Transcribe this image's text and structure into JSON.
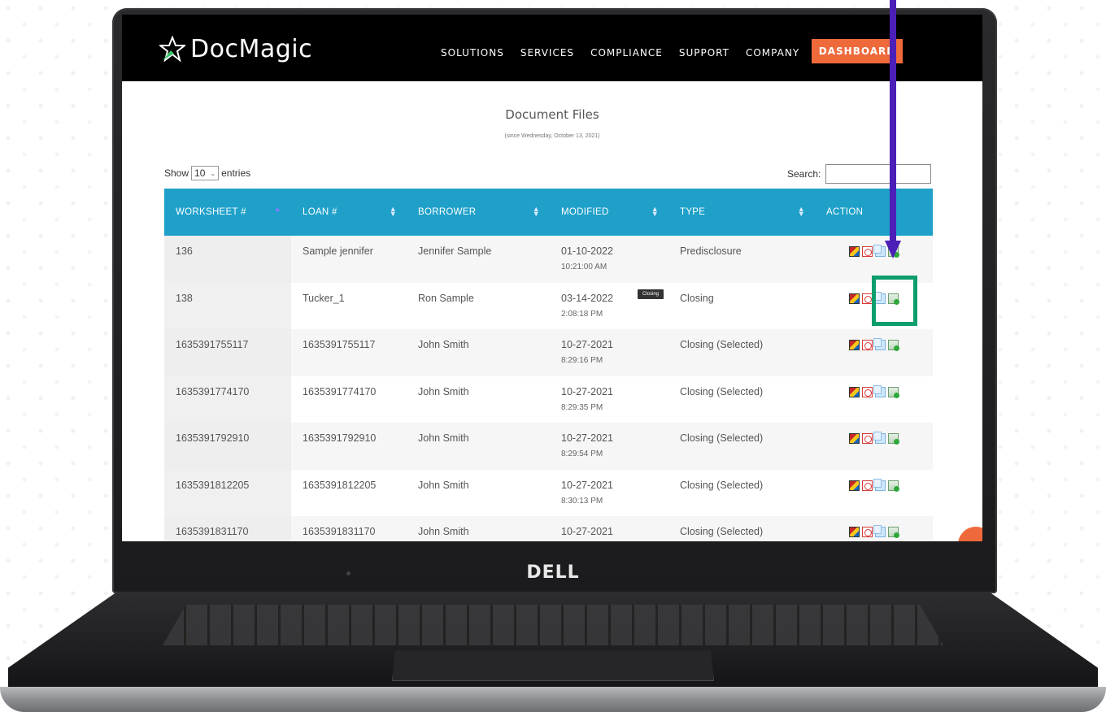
{
  "app": {
    "brand": "DocMagic",
    "nav": [
      "SOLUTIONS",
      "SERVICES",
      "COMPLIANCE",
      "SUPPORT",
      "COMPANY"
    ],
    "dashboard_label": "DASHBOARD"
  },
  "page": {
    "title": "Document Files",
    "subtitle": "(since Wednesday, October 13, 2021)"
  },
  "controls": {
    "show_label": "Show",
    "entries_value": "10",
    "entries_label": "entries",
    "search_label": "Search:",
    "search_value": ""
  },
  "table": {
    "headers": [
      "WORKSHEET #",
      "LOAN #",
      "BORROWER",
      "MODIFIED",
      "TYPE",
      "ACTION"
    ],
    "rows": [
      {
        "worksheet": "136",
        "loan": "Sample jennifer",
        "borrower": "Jennifer Sample",
        "date": "01-10-2022",
        "time": "10:21:00 AM",
        "type": "Predisclosure"
      },
      {
        "worksheet": "138",
        "loan": "Tucker_1",
        "borrower": "Ron Sample",
        "date": "03-14-2022",
        "time": "2:08:18 PM",
        "type": "Closing"
      },
      {
        "worksheet": "1635391755117",
        "loan": "1635391755117",
        "borrower": "John Smith",
        "date": "10-27-2021",
        "time": "8:29:16 PM",
        "type": "Closing (Selected)"
      },
      {
        "worksheet": "1635391774170",
        "loan": "1635391774170",
        "borrower": "John Smith",
        "date": "10-27-2021",
        "time": "8:29:35 PM",
        "type": "Closing (Selected)"
      },
      {
        "worksheet": "1635391792910",
        "loan": "1635391792910",
        "borrower": "John Smith",
        "date": "10-27-2021",
        "time": "8:29:54 PM",
        "type": "Closing (Selected)"
      },
      {
        "worksheet": "1635391812205",
        "loan": "1635391812205",
        "borrower": "John Smith",
        "date": "10-27-2021",
        "time": "8:30:13 PM",
        "type": "Closing (Selected)"
      },
      {
        "worksheet": "1635391831170",
        "loan": "1635391831170",
        "borrower": "John Smith",
        "date": "10-27-2021",
        "time": "",
        "type": "Closing (Selected)"
      }
    ]
  },
  "tooltip": "Closing",
  "device": {
    "brand": "DELL"
  },
  "colors": {
    "header_blue": "#1ea0c9",
    "dashboard_orange": "#ef6a3b",
    "arrow_purple": "#4b1fb8",
    "highlight_green": "#0e9e6c"
  }
}
